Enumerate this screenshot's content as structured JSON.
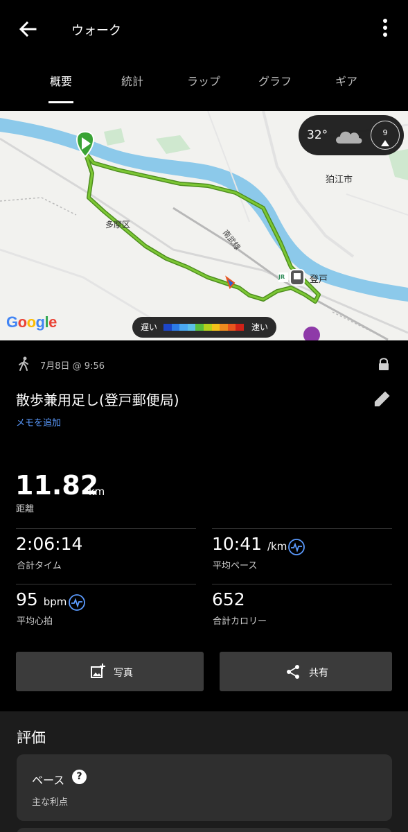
{
  "header": {
    "title": "ウォーク",
    "back_icon": "arrow-left-icon",
    "more_icon": "more-vertical-icon"
  },
  "tabs": [
    {
      "label": "概要",
      "active": true
    },
    {
      "label": "統計",
      "active": false
    },
    {
      "label": "ラップ",
      "active": false
    },
    {
      "label": "グラフ",
      "active": false
    },
    {
      "label": "ギア",
      "active": false
    }
  ],
  "map": {
    "labels": {
      "city": "狛江市",
      "ward": "多摩区",
      "line": "南武線",
      "station": "登戸",
      "jr": "JR"
    },
    "weather": {
      "temperature": "32°",
      "wind_speed": "9",
      "icon": "cloud-icon"
    },
    "legend": {
      "slow": "遅い",
      "fast": "速い",
      "colors": [
        "#1d46c8",
        "#2c7be6",
        "#4aa8f0",
        "#5cc0e8",
        "#5bbf3c",
        "#b6d11c",
        "#f5c21a",
        "#f08b1e",
        "#e8551d",
        "#d02218"
      ]
    },
    "attribution": "Google",
    "route_color": "#6dbb2c",
    "river_color": "#8cc9ea"
  },
  "activity": {
    "type_icon": "walking-icon",
    "date": "7月8日 @ 9:56",
    "lock_icon": "lock-icon",
    "title": "散歩兼用足し(登戸郵便局)",
    "edit_icon": "pencil-icon",
    "add_memo": "メモを追加"
  },
  "stats": {
    "distance": {
      "value": "11.82",
      "unit": "km",
      "label": "距離"
    },
    "total_time": {
      "value": "2:06:14",
      "label": "合計タイム"
    },
    "avg_pace": {
      "value": "10:41",
      "unit": "/km",
      "label": "平均ペース",
      "icon": "pulse-chart-icon"
    },
    "avg_hr": {
      "value": "95",
      "unit": "bpm",
      "label": "平均心拍",
      "icon": "pulse-chart-icon"
    },
    "calories": {
      "value": "652",
      "label": "合計カロリー"
    }
  },
  "actions": {
    "photo_label": "写真",
    "photo_icon": "add-photo-icon",
    "share_label": "共有",
    "share_icon": "share-icon"
  },
  "rating": {
    "title": "評価",
    "card_name": "ベース",
    "card_help": "?",
    "card_desc": "主な利点"
  },
  "colors": {
    "background": "#000000",
    "link": "#5b9bff",
    "button": "#3b3b3b",
    "card": "#2f2f2f",
    "pulse_icon": "#5b9bff"
  }
}
